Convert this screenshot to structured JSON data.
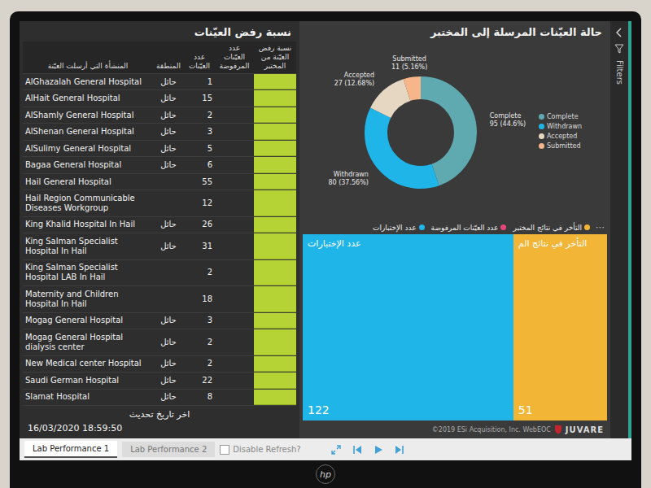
{
  "left_panel": {
    "title": "نسبة رفض العيّنات",
    "table": {
      "columns": [
        "المنشأة التي أرسلت العيّنة",
        "المنطقة",
        "عدد العيّنات",
        "عدد العيّنات المرفوضة",
        "نسبة رفض العيّنة من المختبر"
      ],
      "rows": [
        {
          "facility": "AlGhazalah General Hospital",
          "region": "حائل",
          "samples": "1"
        },
        {
          "facility": "AlHait General Hospital",
          "region": "حائل",
          "samples": "15"
        },
        {
          "facility": "AlShamly General Hospital",
          "region": "حائل",
          "samples": "2"
        },
        {
          "facility": "AlShenan General Hospital",
          "region": "حائل",
          "samples": "3"
        },
        {
          "facility": "AlSulimy General Hospital",
          "region": "حائل",
          "samples": "5"
        },
        {
          "facility": "Bagaa General Hospital",
          "region": "حائل",
          "samples": "6"
        },
        {
          "facility": "Hail General Hospital",
          "samples": "55"
        },
        {
          "facility": "Hail Region Communicable Diseases Workgroup",
          "samples": "12"
        },
        {
          "facility": "King Khalid Hospital In Hail",
          "region": "حائل",
          "samples": "26"
        },
        {
          "facility": "King Salman Specialist Hospital In Hail",
          "region": "حائل",
          "samples": "31"
        },
        {
          "facility": "King Salman Specialist Hospital LAB In Hail",
          "samples": "2"
        },
        {
          "facility": "Maternity and Children Hospital In Hail",
          "samples": "18"
        },
        {
          "facility": "Mogag General Hospital",
          "region": "حائل",
          "samples": "3"
        },
        {
          "facility": "Mogag General Hospital dialysis center",
          "region": "حائل",
          "samples": "2"
        },
        {
          "facility": "New Medical center Hospital",
          "region": "حائل",
          "samples": "2"
        },
        {
          "facility": "Saudi German Hospital",
          "region": "حائل",
          "samples": "22"
        },
        {
          "facility": "Slamat Hospital",
          "region": "حائل",
          "samples": "8"
        }
      ]
    },
    "last_update": {
      "label": "اخر تاريخ تحديث",
      "value": "16/03/2020 18:59:50"
    }
  },
  "status_chart": {
    "title": "حالة العيّنات المرسلة إلى المختبر",
    "series": [
      {
        "label": "Complete",
        "value": 95,
        "reading": "95 (44.6%)",
        "color": "#5fa9b1"
      },
      {
        "label": "Withdrawn",
        "value": 80,
        "reading": "80 (37.56%)",
        "color": "#1fb5e8"
      },
      {
        "label": "Accepted",
        "value": 27,
        "reading": "27 (12.68%)",
        "color": "#e6d7c3"
      },
      {
        "label": "Submitted",
        "value": 11,
        "reading": "11 (5.16%)",
        "color": "#f7b58a"
      }
    ]
  },
  "treemap": {
    "legend": [
      {
        "label": "التأخر في نتائج المختبر",
        "color": "#f2b535"
      },
      {
        "label": "عدد العيّنات المرفوضة",
        "color": "#e8457a"
      },
      {
        "label": "عدد الإختبارات",
        "color": "#1fb5e8"
      }
    ],
    "more": "⋯",
    "tiles": [
      {
        "label": "عدد الإختبارات",
        "reading": "122",
        "value": 122,
        "color": "#1fb5e8"
      },
      {
        "label": "التأخر في نتائج الم",
        "reading": "51",
        "value": 51,
        "color": "#f2b535"
      }
    ]
  },
  "footer": {
    "copyright": "©2019 ESi Acquisition, Inc. WebEOC",
    "brand": "JUVARE"
  },
  "filters": {
    "label": "Filters"
  },
  "bottom_bar": {
    "pages": [
      {
        "label": "Lab Performance 1",
        "selected": true
      },
      {
        "label": "Lab Performance 2",
        "selected": false
      }
    ],
    "refresh_toggle": {
      "label": "Disable Refresh?",
      "checked": false
    }
  },
  "monitor": {
    "logo": "hp"
  }
}
